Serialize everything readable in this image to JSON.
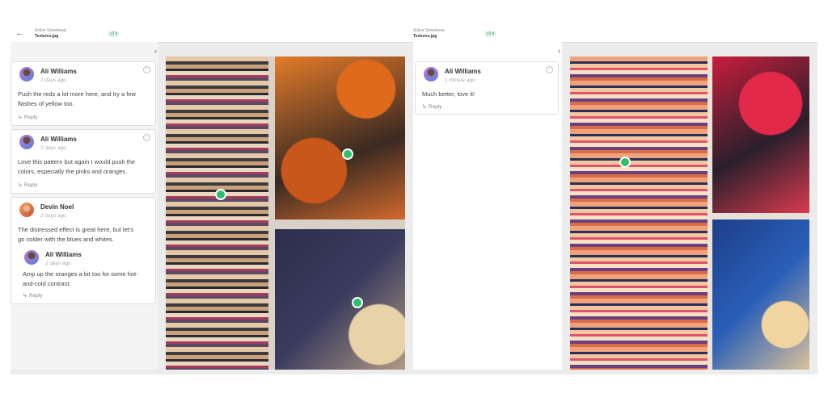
{
  "left_view": {
    "project": "Active Streetwear",
    "file": "Textures.jpg",
    "version": "v2 ▾",
    "comments": [
      {
        "author": "Ali Williams",
        "time": "2 days ago",
        "text_line1": "Push the reds a lot more here, and try a few",
        "text_line2": "flashes of yellow too.",
        "reply": "Reply"
      },
      {
        "author": "Ali Williams",
        "time": "2 days ago",
        "text_line1": "Love this pattern but again I would push the",
        "text_line2": "colors, especially the pinks and oranges.",
        "reply": "Reply"
      },
      {
        "author": "Devin Noel",
        "time": "2 days ago",
        "text_line1": "The distressed effect is great here, but let's",
        "text_line2": "go colder with the blues and whites.",
        "nested": {
          "author": "Ali Williams",
          "time": "2 days ago",
          "text_line1": "Amp up the oranges a bit too for some hot-",
          "text_line2": "and-cold contrast.",
          "reply": "Reply"
        }
      }
    ]
  },
  "right_view": {
    "project": "Active Streetwear",
    "file": "Textures.jpg",
    "version": "v3 ▾",
    "comments": [
      {
        "author": "Ali Williams",
        "time": "1 minute ago",
        "text": "Much better, love it!",
        "reply": "Reply"
      }
    ]
  },
  "icons": {
    "back": "back-arrow-icon",
    "collapse": "chevron-right-icon",
    "reply": "reply-arrow-icon",
    "resolve": "resolve-check-icon"
  },
  "colors": {
    "pin": "#2dbf6c",
    "version_badge": "#2e9a5c"
  }
}
